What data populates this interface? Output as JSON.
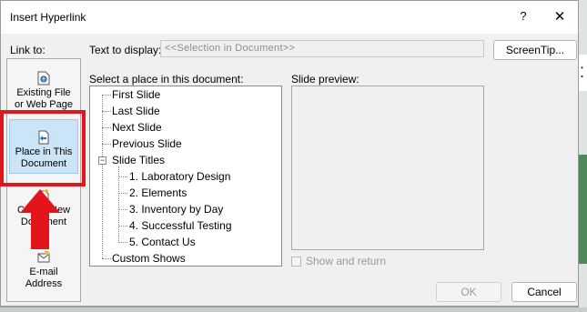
{
  "dialog": {
    "title": "Insert Hyperlink",
    "help": "?",
    "close": "✕"
  },
  "link_to": {
    "label": "Link to:",
    "items": [
      {
        "label_1": "Existing File",
        "label_2": "or Web Page",
        "icon": "web-page-icon"
      },
      {
        "label_1": "Place in This",
        "label_2": "Document",
        "icon": "place-in-document-icon",
        "selected": true
      },
      {
        "label_1": "Create New",
        "label_2": "Document",
        "icon": "new-document-icon"
      },
      {
        "label_1": "E-mail",
        "label_2": "Address",
        "icon": "email-icon"
      }
    ]
  },
  "text_to_display": {
    "label": "Text to display:",
    "value": "<<Selection in Document>>"
  },
  "screentip_button": "ScreenTip...",
  "place_list": {
    "label": "Select a place in this document:",
    "nodes": [
      "First Slide",
      "Last Slide",
      "Next Slide",
      "Previous Slide",
      "Slide Titles"
    ],
    "slide_titles": [
      "1. Laboratory Design",
      "2. Elements",
      "3. Inventory by Day",
      "4. Successful Testing",
      "5. Contact Us"
    ],
    "custom_shows": "Custom Shows"
  },
  "preview": {
    "label": "Slide preview:",
    "show_and_return": "Show and return"
  },
  "buttons": {
    "ok": "OK",
    "cancel": "Cancel"
  },
  "annotation": {
    "color": "#e2141c"
  }
}
